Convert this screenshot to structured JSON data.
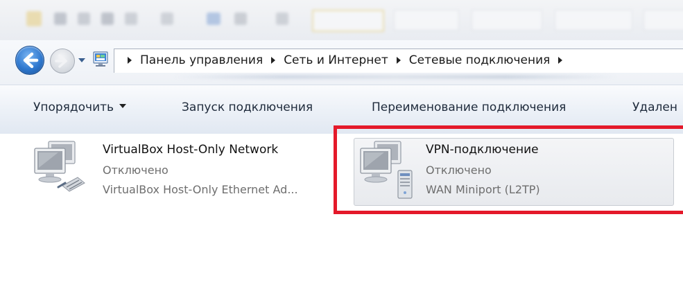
{
  "address_bar": {
    "breadcrumbs": [
      "Панель управления",
      "Сеть и Интернет",
      "Сетевые подключения"
    ]
  },
  "command_bar": {
    "organize": "Упорядочить",
    "start_connection": "Запуск подключения",
    "rename_connection": "Переименование подключения",
    "delete_partial": "Удален"
  },
  "connections": [
    {
      "name": "VirtualBox Host-Only Network",
      "status": "Отключено",
      "device": "VirtualBox Host-Only Ethernet Ad..."
    },
    {
      "name": "VPN-подключение",
      "status": "Отключено",
      "device": "WAN Miniport (L2TP)"
    }
  ],
  "colors": {
    "highlight": "#e4192a",
    "status_text": "#6e6e6e"
  }
}
